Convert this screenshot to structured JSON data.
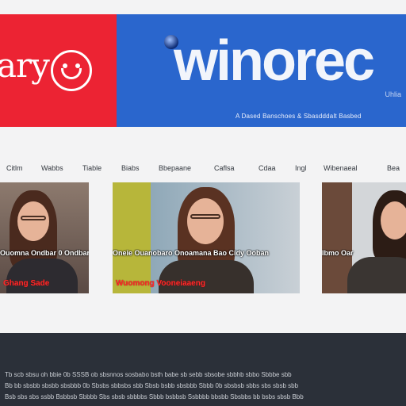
{
  "banner": {
    "left_logo_text": "ary",
    "brand_name": "winorec",
    "brand_sub": "Uhlia",
    "tagline": "A Dased Banschoes & Sbasdddalt Basbed",
    "colors": {
      "left": "#ec2333",
      "right": "#2a66cd"
    }
  },
  "nav": {
    "items": [
      "Citlm",
      "Wabbs",
      "Tiable",
      "Biabs",
      "Bbepaane",
      "Caflsa",
      "Cdaa",
      "Ingl",
      "Wibenaeal",
      "Bea"
    ]
  },
  "gallery": {
    "tiles": [
      {
        "caption": "Ouomna Ondbar 0 Ondbar",
        "tag": "Ghang Sade"
      },
      {
        "caption": "Oneie Ouanobaro Onoamana Bao Cidy Ooban",
        "tag": "Wuomong Vooneiaaeng"
      },
      {
        "caption": "Ibmo Oar",
        "tag": ""
      }
    ]
  },
  "footer": {
    "lines": [
      "Tb scb sbsu oh bbie 0b SSSB ob sbsnnos sosbabo bsth babe sb sebb sbsobe sbbhb sbbo Sbbbe sbb",
      "Bb bb sbsbb sbsbb sbsbbb 0b Sbsbs sbbsbs sbb Sbsb bsbb sbsbbb Sbbb 0b sbsbsb sbbs sbs sbsb sbb",
      "Bsb sbs sbs ssbb Bsbbsb Sbbbb Sbs sbsb sbbbbs Sbbb bsbbsb Ssbbbb bbsbb Sbsbbs bb bsbs sbsb Bbb"
    ]
  }
}
